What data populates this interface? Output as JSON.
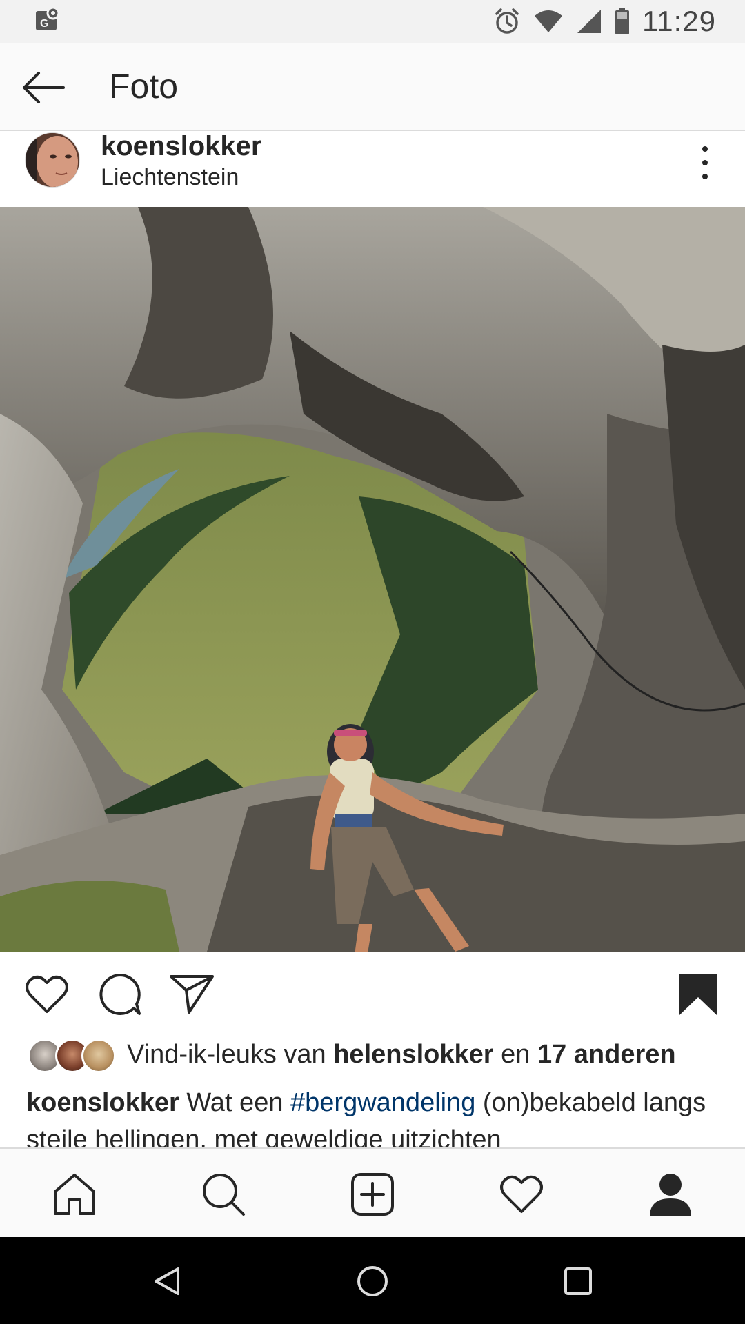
{
  "status_bar": {
    "time": "11:29",
    "icons": [
      "maps-notification-icon",
      "alarm-icon",
      "wifi-icon",
      "signal-icon",
      "battery-icon"
    ]
  },
  "app_bar": {
    "title": "Foto",
    "back_icon": "arrow-left-icon"
  },
  "post": {
    "username": "koenslokker",
    "location": "Liechtenstein",
    "photo_subject": "hiker-on-rocky-mountain-path",
    "actions": {
      "like_icon": "heart-outline-icon",
      "comment_icon": "comment-bubble-icon",
      "share_icon": "paper-plane-icon",
      "save_icon": "bookmark-filled-icon"
    },
    "likes": {
      "prefix": "Vind-ik-leuks van ",
      "user": "helenslokker",
      "middle": " en ",
      "others": "17 anderen"
    },
    "caption": {
      "author": "koenslokker",
      "text_before": " Wat een ",
      "hashtag": "#bergwandeling",
      "text_after": " (on)bekabeld langs steile hellingen, met geweldige uitzichten"
    }
  },
  "tab_bar": {
    "tabs": [
      "home-icon",
      "search-icon",
      "add-post-icon",
      "activity-heart-icon",
      "profile-icon"
    ],
    "active": "profile-icon"
  },
  "nav_bar": {
    "buttons": [
      "back-triangle-icon",
      "home-circle-icon",
      "recents-square-icon"
    ]
  },
  "colors": {
    "hashtag": "#003569",
    "text": "#262626",
    "bar_background": "#fafafa",
    "divider": "#dbdbdb"
  }
}
